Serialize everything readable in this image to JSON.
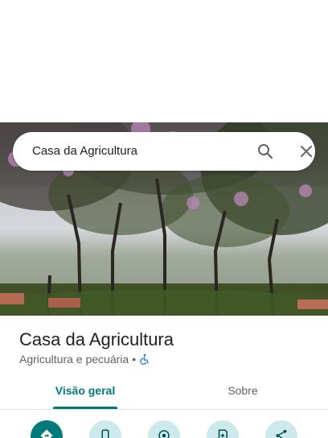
{
  "search": {
    "query": "Casa da Agricultura"
  },
  "place": {
    "name": "Casa da Agricultura",
    "category": "Agricultura e pecuária",
    "separator": "•"
  },
  "tabs": [
    {
      "label": "Visão geral",
      "active": true
    },
    {
      "label": "Sobre",
      "active": false
    }
  ],
  "icons": {
    "search": "search-icon",
    "close": "close-icon",
    "accessibility": "wheelchair-icon",
    "directions": "directions-icon",
    "call": "phone-icon",
    "nearby": "nearby-icon",
    "save": "save-icon",
    "share": "share-icon"
  },
  "colors": {
    "accent": "#007a7a",
    "accent_light": "#cde9ec",
    "accessibility": "#1a73e8"
  }
}
